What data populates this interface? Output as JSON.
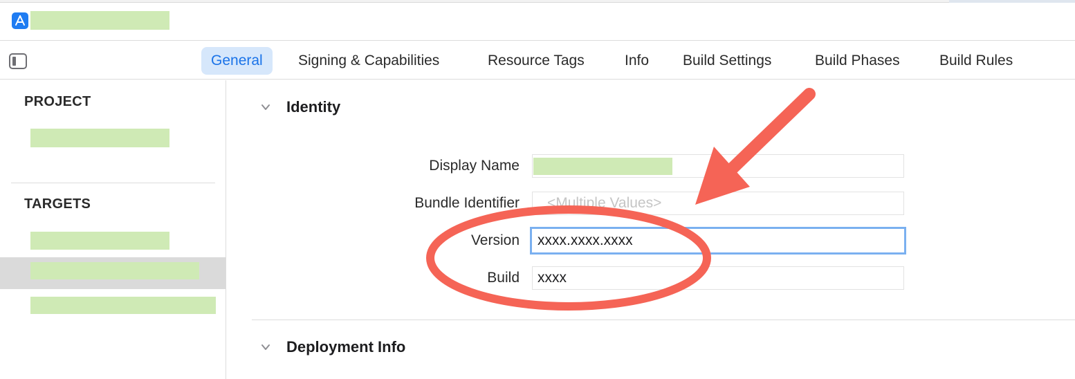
{
  "tabs": [
    {
      "label": "General",
      "active": true
    },
    {
      "label": "Signing & Capabilities",
      "active": false
    },
    {
      "label": "Resource Tags",
      "active": false
    },
    {
      "label": "Info",
      "active": false
    },
    {
      "label": "Build Settings",
      "active": false
    },
    {
      "label": "Build Phases",
      "active": false
    },
    {
      "label": "Build Rules",
      "active": false
    }
  ],
  "sidebar": {
    "project_heading": "PROJECT",
    "targets_heading": "TARGETS"
  },
  "identity": {
    "title": "Identity",
    "display_name_label": "Display Name",
    "bundle_identifier_label": "Bundle Identifier",
    "bundle_identifier_placeholder": "<Multiple Values>",
    "version_label": "Version",
    "version_value": "xxxx.xxxx.xxxx",
    "build_label": "Build",
    "build_value": "xxxx"
  },
  "deployment": {
    "title": "Deployment Info"
  },
  "icons": {
    "app": "app-store-icon",
    "sidebar_toggle": "sidebar-toggle-icon",
    "disclosure": "chevron-down-icon"
  },
  "colors": {
    "accent": "#1a73e8",
    "active_tab_bg": "#d6e7fb",
    "focus_ring": "#7ab0f0",
    "annotation": "#f56456",
    "redaction": "#cfeab5"
  }
}
